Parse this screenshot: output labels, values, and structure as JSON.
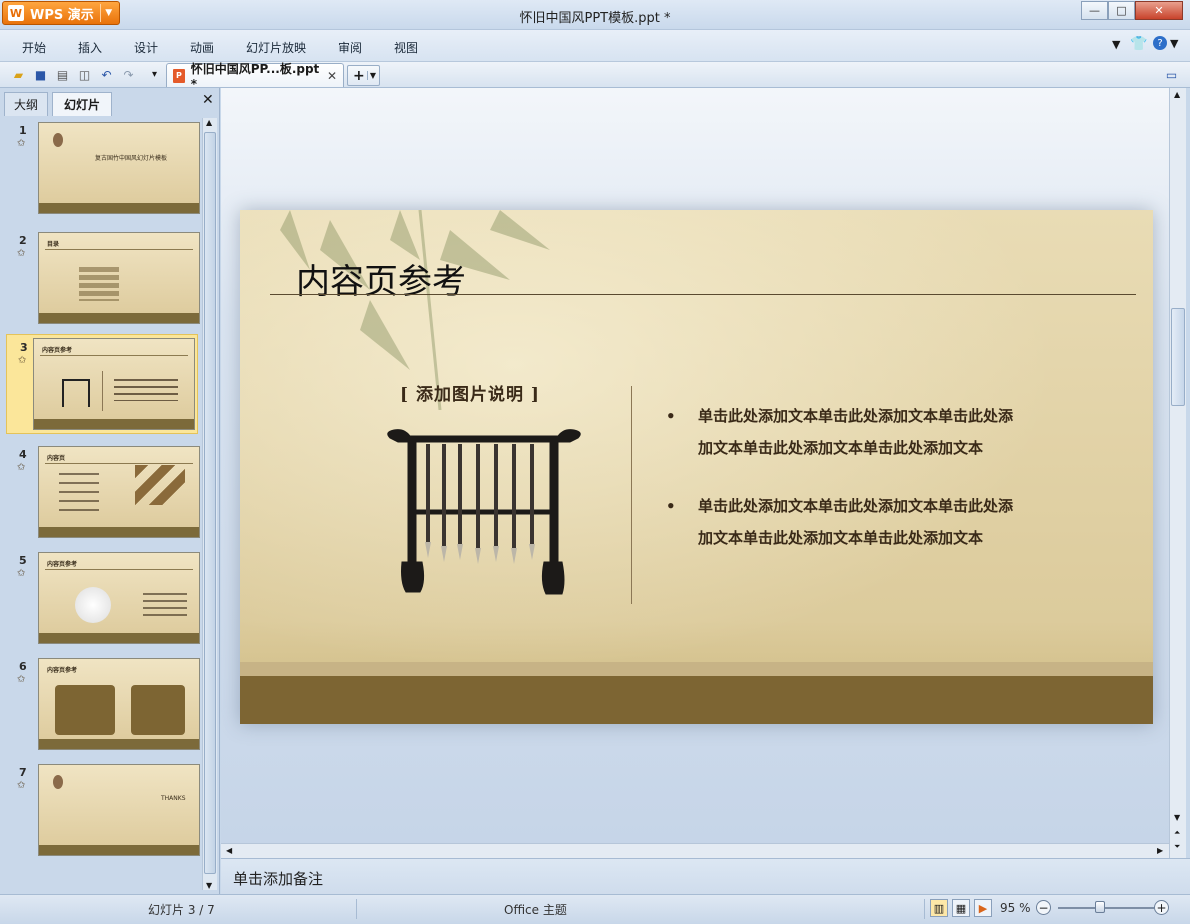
{
  "app": {
    "name": "WPS 演示",
    "window_title": "怀旧中国风PPT模板.ppt *"
  },
  "window_controls": {
    "minimize": "—",
    "maximize": "□",
    "close": "✕"
  },
  "menu": [
    "开始",
    "插入",
    "设计",
    "动画",
    "幻灯片放映",
    "审阅",
    "视图"
  ],
  "toolbar": {
    "icons": [
      "open-icon",
      "save-icon",
      "print-icon",
      "print-preview-icon",
      "undo-icon",
      "redo-icon"
    ],
    "dropdown": "▾",
    "doc_tab_label": "怀旧中国风PP...板.ppt *",
    "doc_tab_close": "✕",
    "new_tab": "+"
  },
  "left_panel": {
    "tabs": [
      "大纲",
      "幻灯片"
    ],
    "active_tab": "幻灯片",
    "close": "✕",
    "slides": [
      {
        "num": "1",
        "title": "复古国竹中国风幻灯片模板"
      },
      {
        "num": "2",
        "title": "目录"
      },
      {
        "num": "3",
        "title": "内容页参考"
      },
      {
        "num": "4",
        "title": "内容页"
      },
      {
        "num": "5",
        "title": "内容页参考"
      },
      {
        "num": "6",
        "title": "内容页参考"
      },
      {
        "num": "7",
        "title": "THANKS"
      }
    ],
    "star": "✩",
    "selected_index": 3
  },
  "slide": {
    "title": "内容页参考",
    "caption": "[ 添加图片说明 ]",
    "bullets": [
      {
        "line1": "单击此处添加文本单击此处添加文本单击此处添",
        "line2": "加文本单击此处添加文本单击此处添加文本"
      },
      {
        "line1": "单击此处添加文本单击此处添加文本单击此处添",
        "line2": "加文本单击此处添加文本单击此处添加文本"
      }
    ]
  },
  "notes_placeholder": "单击添加备注",
  "status": {
    "slide_position": "幻灯片 3 / 7",
    "theme": "Office 主题",
    "zoom": "95 %",
    "zoom_level_percent": 95
  },
  "colors": {
    "accent": "#e9720a",
    "slide_bg": "#e4d6ad",
    "ground": "#7d6533",
    "selected_thumb": "#fbe69a"
  }
}
